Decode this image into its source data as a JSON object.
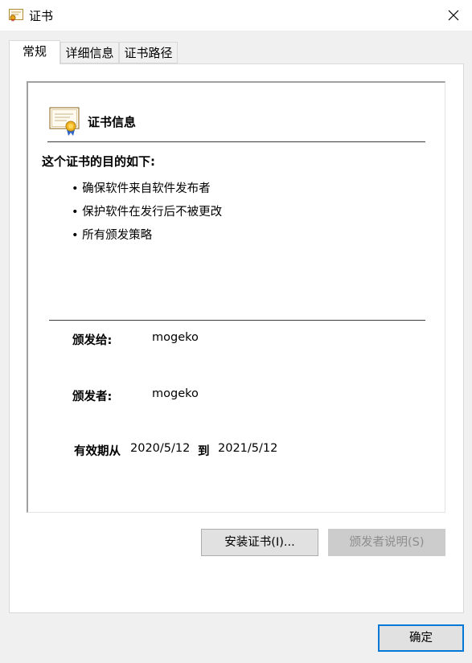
{
  "window": {
    "title": "证书",
    "close_glyph": "✕"
  },
  "tabs": [
    {
      "label": "常规",
      "active": true
    },
    {
      "label": "详细信息",
      "active": false
    },
    {
      "label": "证书路径",
      "active": false
    }
  ],
  "general": {
    "header": "证书信息",
    "purpose_title": "这个证书的目的如下:",
    "purposes": [
      "确保软件来自软件发布者",
      "保护软件在发行后不被更改",
      "所有颁发策略"
    ],
    "issued_to_label": "颁发给:",
    "issued_to_value": "mogeko",
    "issued_by_label": "颁发者:",
    "issued_by_value": "mogeko",
    "valid_from_label": "有效期从",
    "valid_from_value": "2020/5/12",
    "valid_to_label": "到",
    "valid_to_value": "2021/5/12"
  },
  "buttons": {
    "install": "安装证书(I)...",
    "issuer_statement": "颁发者说明(S)",
    "ok": "确定"
  },
  "icons": {
    "title": "certificate-icon",
    "close": "close-icon",
    "header": "certificate-ribbon-icon"
  }
}
